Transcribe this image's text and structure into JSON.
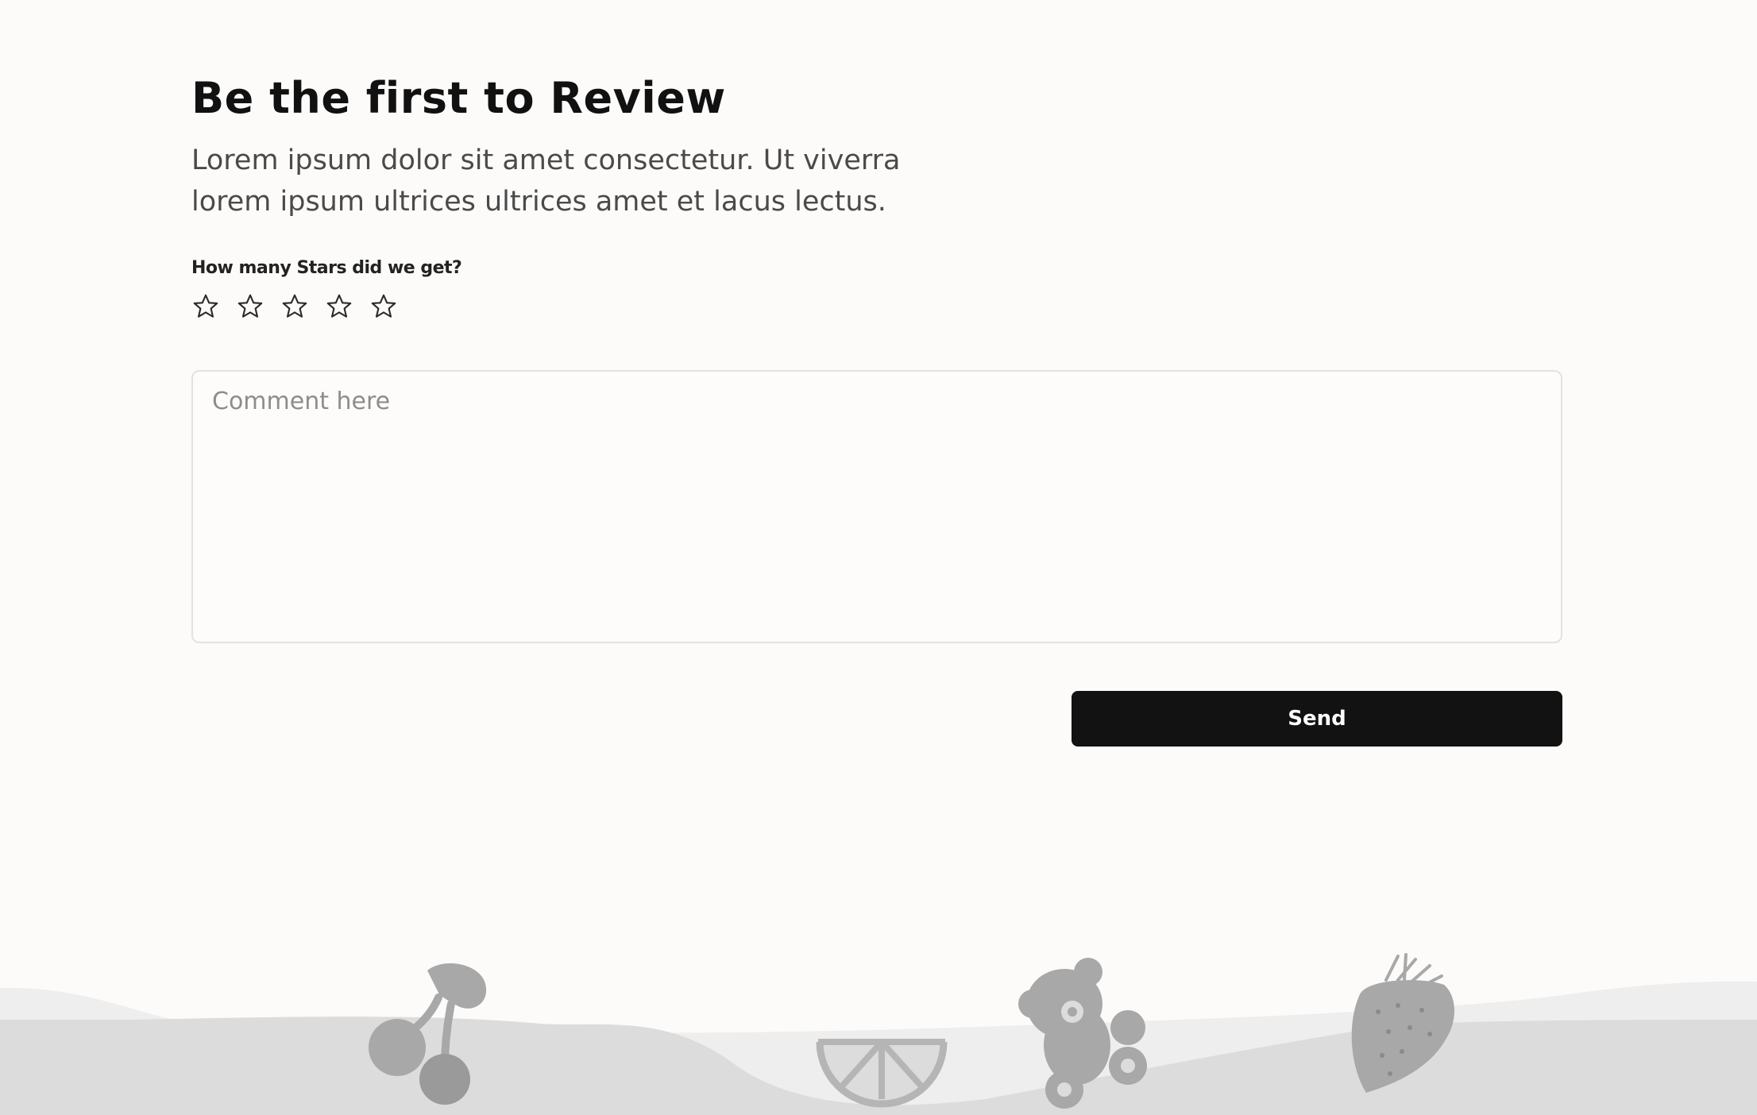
{
  "review": {
    "title": "Be the first to Review",
    "description": "Lorem ipsum dolor sit amet consectetur. Ut viverra lorem ipsum ultrices ultrices amet et lacus lectus.",
    "rating_question": "How many Stars did we get?",
    "rating": {
      "max": 5,
      "selected": 0
    },
    "comment": {
      "placeholder": "Comment here",
      "value": ""
    },
    "send_label": "Send"
  },
  "icons": {
    "star": "star-outline-icon",
    "footer": [
      "cherries-icon",
      "orange-slice-icon",
      "teddy-bear-icon",
      "strawberry-icon"
    ]
  },
  "colors": {
    "background": "#fcfbf9",
    "send_button": "#121212",
    "footer_wave_light": "#eeeeee",
    "footer_wave_dark": "#dcdcdc",
    "footer_icon": "#a8a8a8"
  }
}
